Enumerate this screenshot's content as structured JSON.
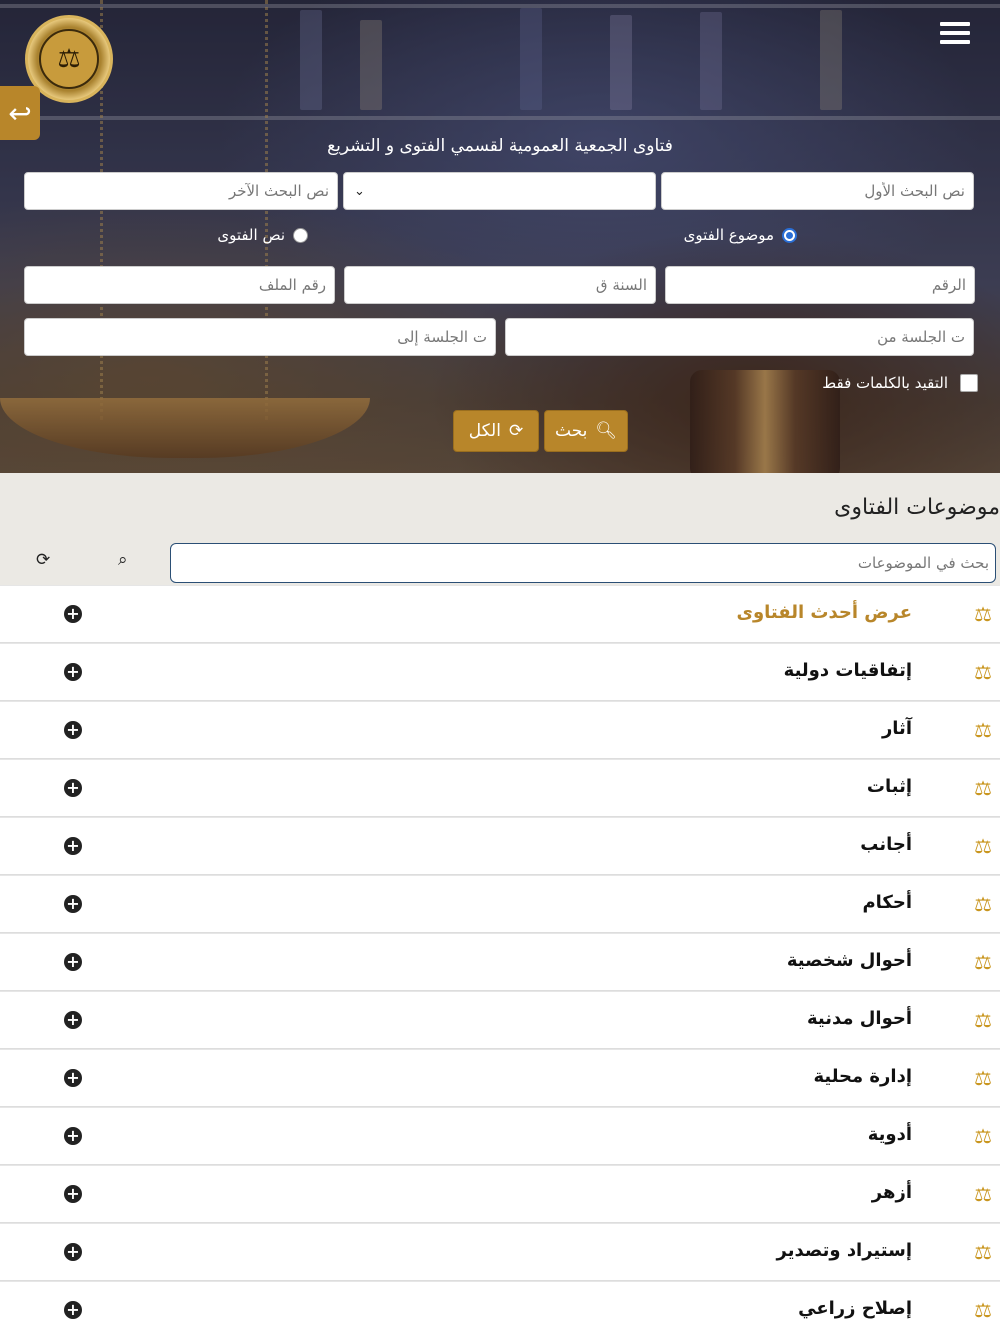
{
  "header": {
    "logo_icon": "scales-of-justice-emblem",
    "menu_icon": "hamburger-menu-icon",
    "back_icon": "reply-arrow-icon",
    "title": "فتاوى الجمعية العمومية لقسمي الفتوى و التشريع"
  },
  "search_form": {
    "first_text_placeholder": "نص البحث الأول",
    "operator_value": "",
    "second_text_placeholder": "نص البحث الآخر",
    "radio_subject_label": "موضوع الفتوى",
    "radio_text_label": "نص الفتوى",
    "radio_selected": "موضوع الفتوى",
    "number_placeholder": "الرقم",
    "year_placeholder": "السنة ق",
    "file_number_placeholder": "رقم الملف",
    "session_from_placeholder": "ت الجلسة من",
    "session_to_placeholder": "ت الجلسة إلى",
    "exact_words_label": "التقيد بالكلمات فقط",
    "search_button_label": "بحث",
    "all_button_label": "الكل"
  },
  "topics": {
    "title": "موضوعات الفتاوى",
    "search_placeholder": "بحث في الموضوعات",
    "items": [
      {
        "label": "عرض أحدث الفتاوى",
        "featured": true
      },
      {
        "label": "إتفاقيات دولية"
      },
      {
        "label": "آثار"
      },
      {
        "label": "إثبات"
      },
      {
        "label": "أجانب"
      },
      {
        "label": "أحكام"
      },
      {
        "label": "أحوال شخصية"
      },
      {
        "label": "أحوال مدنية"
      },
      {
        "label": "إدارة محلية"
      },
      {
        "label": "أدوية"
      },
      {
        "label": "أزهر"
      },
      {
        "label": "إستيراد وتصدير"
      },
      {
        "label": "إصلاح زراعي"
      }
    ]
  },
  "colors": {
    "accent": "#b8862a",
    "icon_gold": "#c9961f",
    "search_border": "#2b4f75",
    "radio_selected": "#2a6fd6"
  }
}
